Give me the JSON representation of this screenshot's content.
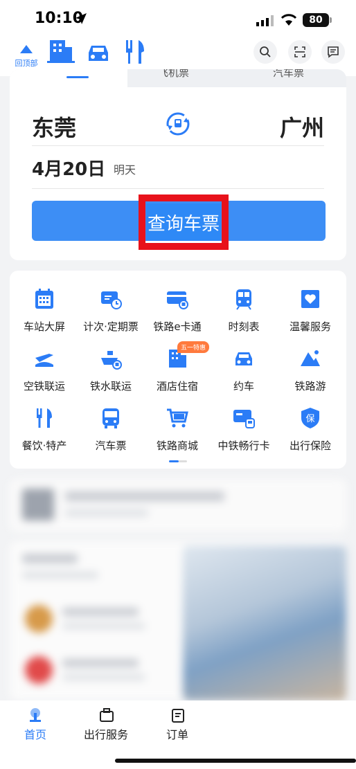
{
  "status": {
    "time": "10:10",
    "battery": "80"
  },
  "nav": {
    "back_top_label": "回顶部"
  },
  "tabs": [
    "飞机票",
    "汽车票"
  ],
  "booking": {
    "from": "东莞",
    "to": "广州",
    "date": "4月20日",
    "date_hint": "明天",
    "search_label": "查询车票"
  },
  "services": [
    {
      "label": "车站大屏",
      "icon": "station-screen-icon"
    },
    {
      "label": "计次·定期票",
      "icon": "ticket-clock-icon"
    },
    {
      "label": "铁路e卡通",
      "icon": "rail-card-icon"
    },
    {
      "label": "时刻表",
      "icon": "train-icon"
    },
    {
      "label": "温馨服务",
      "icon": "heart-service-icon"
    },
    {
      "label": "空铁联运",
      "icon": "plane-train-icon"
    },
    {
      "label": "铁水联运",
      "icon": "ship-train-icon"
    },
    {
      "label": "酒店住宿",
      "icon": "hotel-icon",
      "badge": "五一特惠"
    },
    {
      "label": "约车",
      "icon": "car-icon"
    },
    {
      "label": "铁路游",
      "icon": "mountain-icon"
    },
    {
      "label": "餐饮·特产",
      "icon": "food-icon"
    },
    {
      "label": "汽车票",
      "icon": "bus-icon"
    },
    {
      "label": "铁路商城",
      "icon": "cart-icon"
    },
    {
      "label": "中铁畅行卡",
      "icon": "travel-card-icon"
    },
    {
      "label": "出行保险",
      "icon": "insurance-icon"
    }
  ],
  "tabbar": {
    "home": "首页",
    "travel": "出行服务",
    "orders": "订单"
  },
  "colors": {
    "accent": "#2b7cf6",
    "highlight": "#e8121b"
  }
}
